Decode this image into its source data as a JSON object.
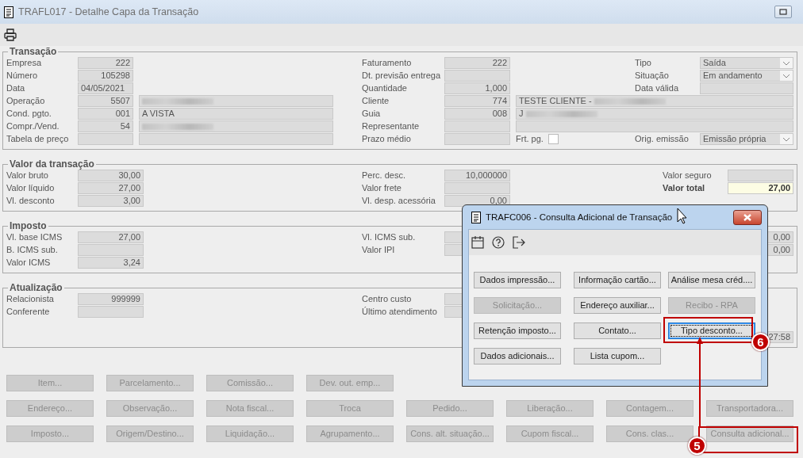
{
  "window": {
    "title": "TRAFL017 - Detalhe Capa da Transação"
  },
  "groups": [
    {
      "title": "Transação",
      "rows": [
        {
          "left": {
            "label": "Empresa",
            "value": "222"
          },
          "middle": {
            "label": "Faturamento",
            "value": "222"
          },
          "right": {
            "label": "Tipo",
            "value": "Saída",
            "kind": "combo"
          }
        },
        {
          "left": {
            "label": "Número",
            "value": "105298"
          },
          "middle": {
            "label": "Dt. previsão entrega"
          },
          "right": {
            "label": "Situação",
            "value": "Em andamento",
            "kind": "combo"
          }
        },
        {
          "left": {
            "label": "Data",
            "value": "04/05/2021",
            "kind": "date"
          },
          "middle": {
            "label": "Quantidade",
            "value": "1,000"
          },
          "right": {
            "label": "Data válida",
            "kind": "field"
          }
        },
        {
          "left": {
            "label": "Operação",
            "value": "5507",
            "note": {
              "redacted": true
            }
          },
          "middle": {
            "label": "Cliente",
            "value": "774",
            "note": {
              "value": "TESTE CLIENTE -",
              "redacted": true
            }
          }
        },
        {
          "left": {
            "label": "Cond. pgto.",
            "value": "001",
            "note": {
              "value": "A VISTA",
              "redacted": false
            }
          },
          "middle": {
            "label": "Guia",
            "value": "008",
            "note": {
              "value": "J",
              "redacted": true
            }
          }
        },
        {
          "left": {
            "label": "Compr./Vend.",
            "value": "54",
            "note": {
              "redacted": true
            }
          },
          "middle": {
            "label": "Representante",
            "note": {
              "redacted": false
            }
          }
        },
        {
          "left": {
            "label": "Tabela de preço",
            "note": {
              "redacted": false
            }
          },
          "middle": {
            "label": "Prazo médio",
            "check": {
              "label": "Frt. pg.",
              "checked": false
            }
          },
          "right": {
            "label": "Orig. emissão",
            "value": "Emissão própria",
            "kind": "combo"
          }
        }
      ]
    },
    {
      "title": "Valor da transação",
      "rows": [
        {
          "left": {
            "label": "Valor bruto",
            "value": "30,00"
          },
          "middle": {
            "label": "Perc. desc.",
            "value": "10,000000"
          },
          "right": {
            "label": "Valor seguro",
            "kind": "field"
          }
        },
        {
          "left": {
            "label": "Valor líquido",
            "value": "27,00"
          },
          "middle": {
            "label": "Valor frete"
          },
          "right": {
            "label": "Valor total",
            "value": "27,00",
            "kind": "total"
          }
        },
        {
          "left": {
            "label": "Vl. desconto",
            "value": "3,00"
          },
          "middle": {
            "label": "Vl. desp. acessória",
            "value": "0,00"
          }
        }
      ]
    },
    {
      "title": "Imposto",
      "rows": [
        {
          "left": {
            "label": "Vl. base ICMS",
            "value": "27,00"
          },
          "middle": {
            "label": "Vl. ICMS sub."
          },
          "right": {
            "value": "0,00",
            "kind": "field"
          }
        },
        {
          "left": {
            "label": "B. ICMS sub."
          },
          "middle": {
            "label": "Valor IPI"
          },
          "right": {
            "value": "0,00",
            "kind": "field"
          }
        },
        {
          "left": {
            "label": "Valor ICMS",
            "value": "3,24"
          }
        }
      ]
    },
    {
      "title": "Atualização",
      "rows": [
        {
          "left": {
            "label": "Relacionista",
            "value": "999999"
          },
          "middle": {
            "label": "Centro custo"
          }
        },
        {
          "left": {
            "label": "Conferente"
          },
          "middle": {
            "label": "Último atendimento"
          }
        },
        {},
        {
          "right": {
            "value": "27:58",
            "kind": "field"
          }
        }
      ]
    }
  ],
  "actions": [
    [
      {
        "label": "Item...",
        "disabled": true
      },
      {
        "label": "Parcelamento...",
        "disabled": true
      },
      {
        "label": "Comissão...",
        "disabled": true
      },
      {
        "label": "Dev. out. emp...",
        "disabled": true
      }
    ],
    [
      {
        "label": "Endereço...",
        "disabled": true
      },
      {
        "label": "Observação...",
        "disabled": true
      },
      {
        "label": "Nota fiscal...",
        "disabled": true
      },
      {
        "label": "Troca",
        "disabled": true
      },
      {
        "label": "Pedido...",
        "disabled": true
      },
      {
        "label": "Liberação...",
        "disabled": true
      },
      {
        "label": "Contagem...",
        "disabled": true
      },
      {
        "label": "Transportadora...",
        "disabled": true
      }
    ],
    [
      {
        "label": "Imposto...",
        "disabled": true
      },
      {
        "label": "Origem/Destino...",
        "disabled": true
      },
      {
        "label": "Liquidação...",
        "disabled": true
      },
      {
        "label": "Agrupamento...",
        "disabled": true
      },
      {
        "label": "Cons. alt. situação...",
        "disabled": true
      },
      {
        "label": "Cupom fiscal...",
        "disabled": true
      },
      {
        "label": "Cons. clas...",
        "disabled": true
      },
      {
        "label": "Consulta adicional...",
        "disabled": true
      }
    ]
  ],
  "dialog": {
    "title": "TRAFC006 - Consulta Adicional de Transação",
    "buttons": [
      {
        "label": "Dados impressão...",
        "disabled": false,
        "focused": false
      },
      {
        "label": "Informação cartão...",
        "disabled": false,
        "focused": false
      },
      {
        "label": "Análise mesa créd....",
        "disabled": false,
        "focused": false
      },
      {
        "label": "Solicitação...",
        "disabled": true,
        "focused": false
      },
      {
        "label": "Endereço auxiliar...",
        "disabled": false,
        "focused": false
      },
      {
        "label": "Recibo - RPA",
        "disabled": true,
        "focused": false
      },
      {
        "label": "Retenção imposto...",
        "disabled": false,
        "focused": false
      },
      {
        "label": "Contato...",
        "disabled": false,
        "focused": false
      },
      {
        "label": "Tipo desconto...",
        "disabled": false,
        "focused": true
      },
      {
        "label": "Dados adicionais...",
        "disabled": false,
        "focused": false
      },
      {
        "label": "Lista cupom...",
        "disabled": false,
        "focused": false
      }
    ]
  },
  "callouts": [
    {
      "number": "6"
    },
    {
      "number": "5"
    }
  ]
}
